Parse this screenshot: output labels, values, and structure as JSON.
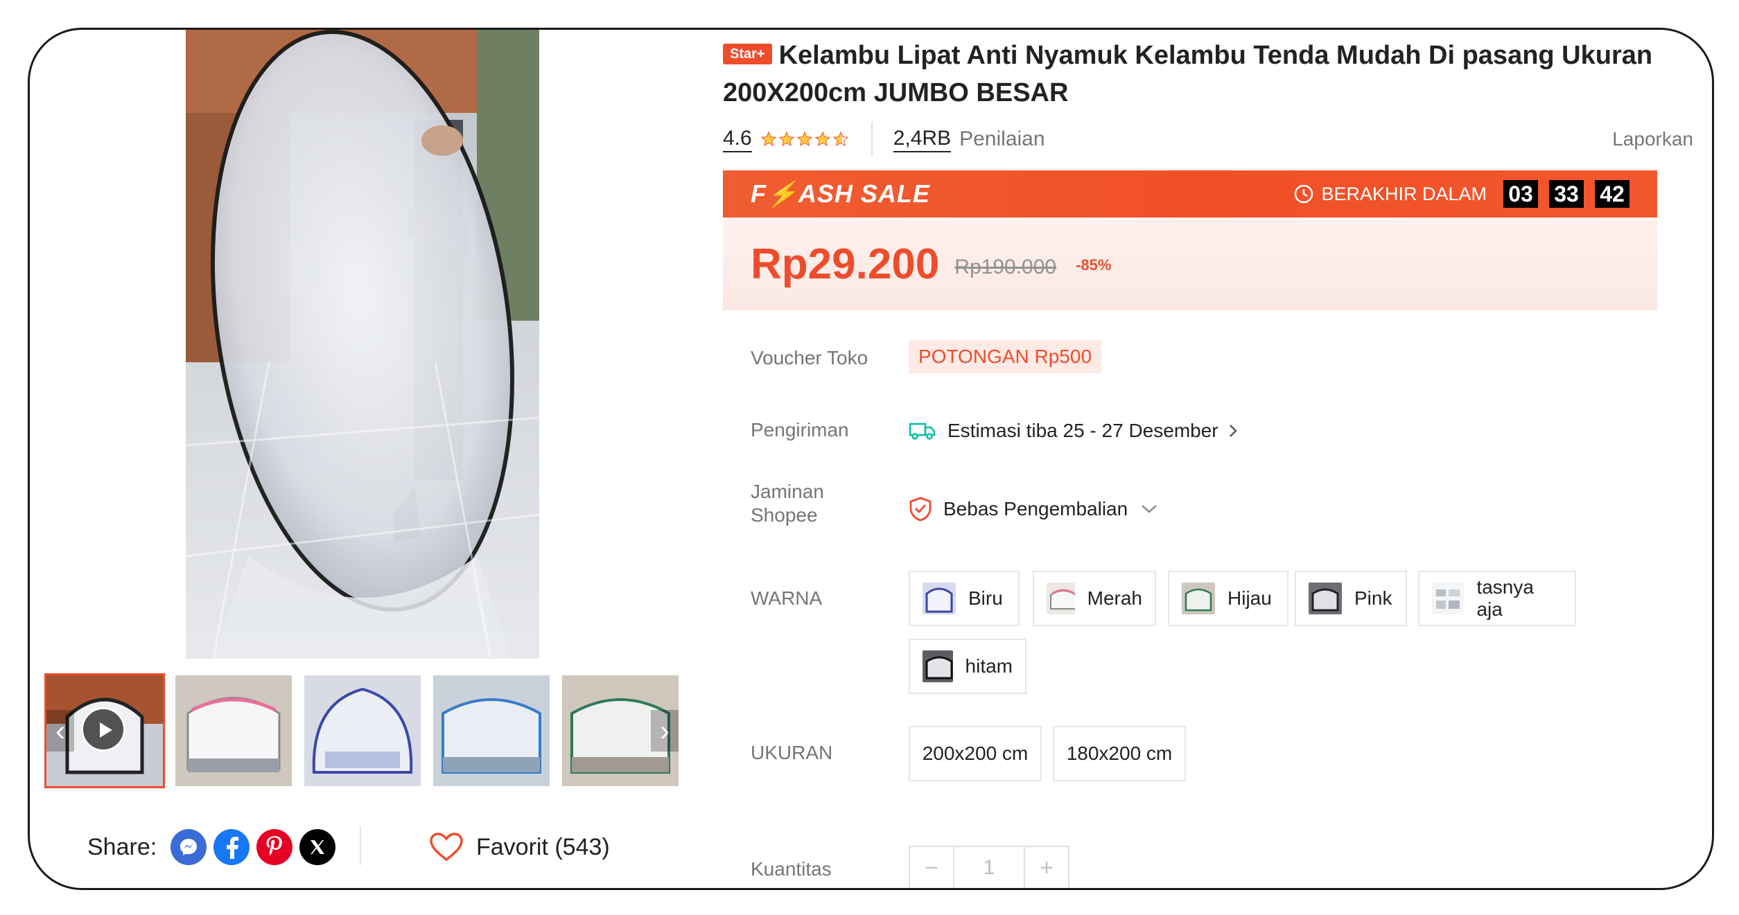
{
  "product": {
    "badge": "Star+",
    "title": "Kelambu Lipat Anti Nyamuk Kelambu Tenda Mudah Di pasang Ukuran 200X200cm JUMBO BESAR",
    "rating": "4.6",
    "rating_stars": 4.6,
    "review_count": "2,4RB",
    "review_label": "Penilaian",
    "report_label": "Laporkan"
  },
  "flash_sale": {
    "title": "F⚡ASH SALE",
    "ends_label": "BERAKHIR DALAM",
    "hours": "03",
    "minutes": "33",
    "seconds": "42"
  },
  "price": {
    "current": "Rp29.200",
    "original": "Rp190.000",
    "discount": "-85%"
  },
  "voucher": {
    "label": "Voucher Toko",
    "value": "POTONGAN Rp500"
  },
  "shipping": {
    "label": "Pengiriman",
    "value": "Estimasi tiba 25 - 27 Desember"
  },
  "guarantee": {
    "label": "Jaminan Shopee",
    "value": "Bebas Pengembalian"
  },
  "colors": {
    "label": "WARNA",
    "options": [
      "Biru",
      "Merah",
      "Hijau",
      "Pink",
      "tasnya aja",
      "hitam"
    ]
  },
  "sizes": {
    "label": "UKURAN",
    "options": [
      "200x200 cm",
      "180x200 cm"
    ]
  },
  "quantity": {
    "label": "Kuantitas",
    "value": "1",
    "minus": "−",
    "plus": "+"
  },
  "share": {
    "label": "Share:",
    "networks": [
      "messenger-icon",
      "facebook-icon",
      "pinterest-icon",
      "x-icon"
    ]
  },
  "favorite": {
    "label": "Favorit (543)"
  },
  "theme": {
    "accent": "#ee4d2d",
    "flash_bg": "#f15026",
    "price_bg": "#fdf1ee",
    "star": "#ffce3d"
  }
}
